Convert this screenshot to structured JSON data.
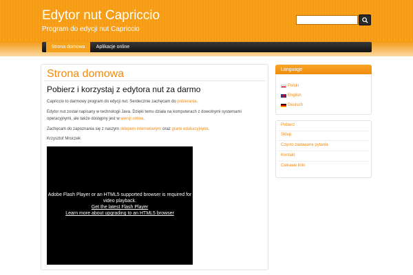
{
  "header": {
    "title": "Edytor nut Capriccio",
    "subtitle": "Program do edycji nut Capriccio",
    "search": {
      "value": "",
      "icon": "search-icon"
    }
  },
  "nav": {
    "items": [
      {
        "label": "Strona domowa",
        "active": true
      },
      {
        "label": "Aplikacje online",
        "active": false
      }
    ]
  },
  "main": {
    "title": "Strona domowa",
    "heading": "Pobierz i korzystaj z edytora nut za darmo",
    "p1_text": "Capriccio to darmowy program do edycji nut. Serdecznie zachęcam do ",
    "p1_link": "pobierania",
    "p1_end": ".",
    "p2_text": "Edytor nut został napisany w technologii Java. Dzięki temu działa na komputerach z dowolnymi systemami operacyjnymi, ale także dostępny jest w ",
    "p2_link": "wersji online",
    "p2_end": ".",
    "p3_text": "Zachęcam do zapoznania się z naszym ",
    "p3_link1": "sklepem internetowym",
    "p3_mid": " oraz ",
    "p3_link2": "grami edukacyjnymi",
    "p3_end": ".",
    "author": "Krzysztof Mroczek",
    "video": {
      "line1": "Adobe Flash Player or an HTML5 supported browser is required for video playback.",
      "link1": "Get the latest Flash Player",
      "link2": "Learn more about upgrading to an HTML5 browser"
    }
  },
  "sidebar": {
    "language": {
      "title": "Language",
      "items": [
        {
          "label": "Polski",
          "flag": "flag-pl"
        },
        {
          "label": "English",
          "flag": "flag-en"
        },
        {
          "label": "Deutsch",
          "flag": "flag-de"
        }
      ]
    },
    "links": [
      "Pobierz",
      "Sklep",
      "Często zadawane pytania",
      "Kontakt",
      "Ciekawe linki"
    ]
  },
  "colors": {
    "accent": "#f28a0c",
    "header": "#f7a21a",
    "nav": "#222222"
  }
}
